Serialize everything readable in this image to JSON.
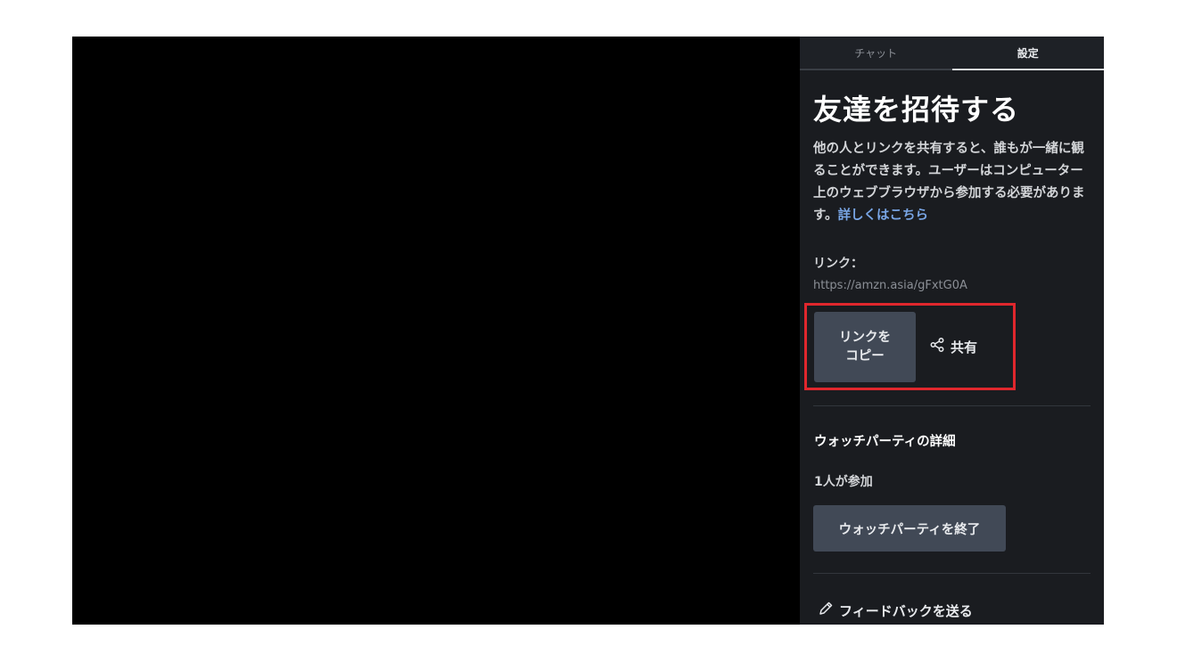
{
  "tabs": [
    {
      "label": "チャット",
      "active": false
    },
    {
      "label": "設定",
      "active": true
    }
  ],
  "invite": {
    "title": "友達を招待する",
    "description": "他の人とリンクを共有すると、誰もが一緒に観ることができます。ユーザーはコンピューター上のウェブブラウザから参加する必要があります。",
    "learn_more": "詳しくはこちら",
    "link_label": "リンク：",
    "link_url": "https://amzn.asia/gFxtG0A",
    "copy_button_line1": "リンクを",
    "copy_button_line2": "コピー",
    "share_label": "共有"
  },
  "party": {
    "section_title": "ウォッチパーティの詳細",
    "participants": "1人が参加",
    "end_button": "ウォッチパーティを終了"
  },
  "feedback": {
    "label": "フィードバックを送る"
  },
  "icons": {
    "share": "share-icon",
    "feedback": "pencil-icon"
  },
  "colors": {
    "panel_bg": "#1a1c20",
    "button_bg": "#414956",
    "link": "#79a6e6",
    "highlight": "#e0272d"
  }
}
